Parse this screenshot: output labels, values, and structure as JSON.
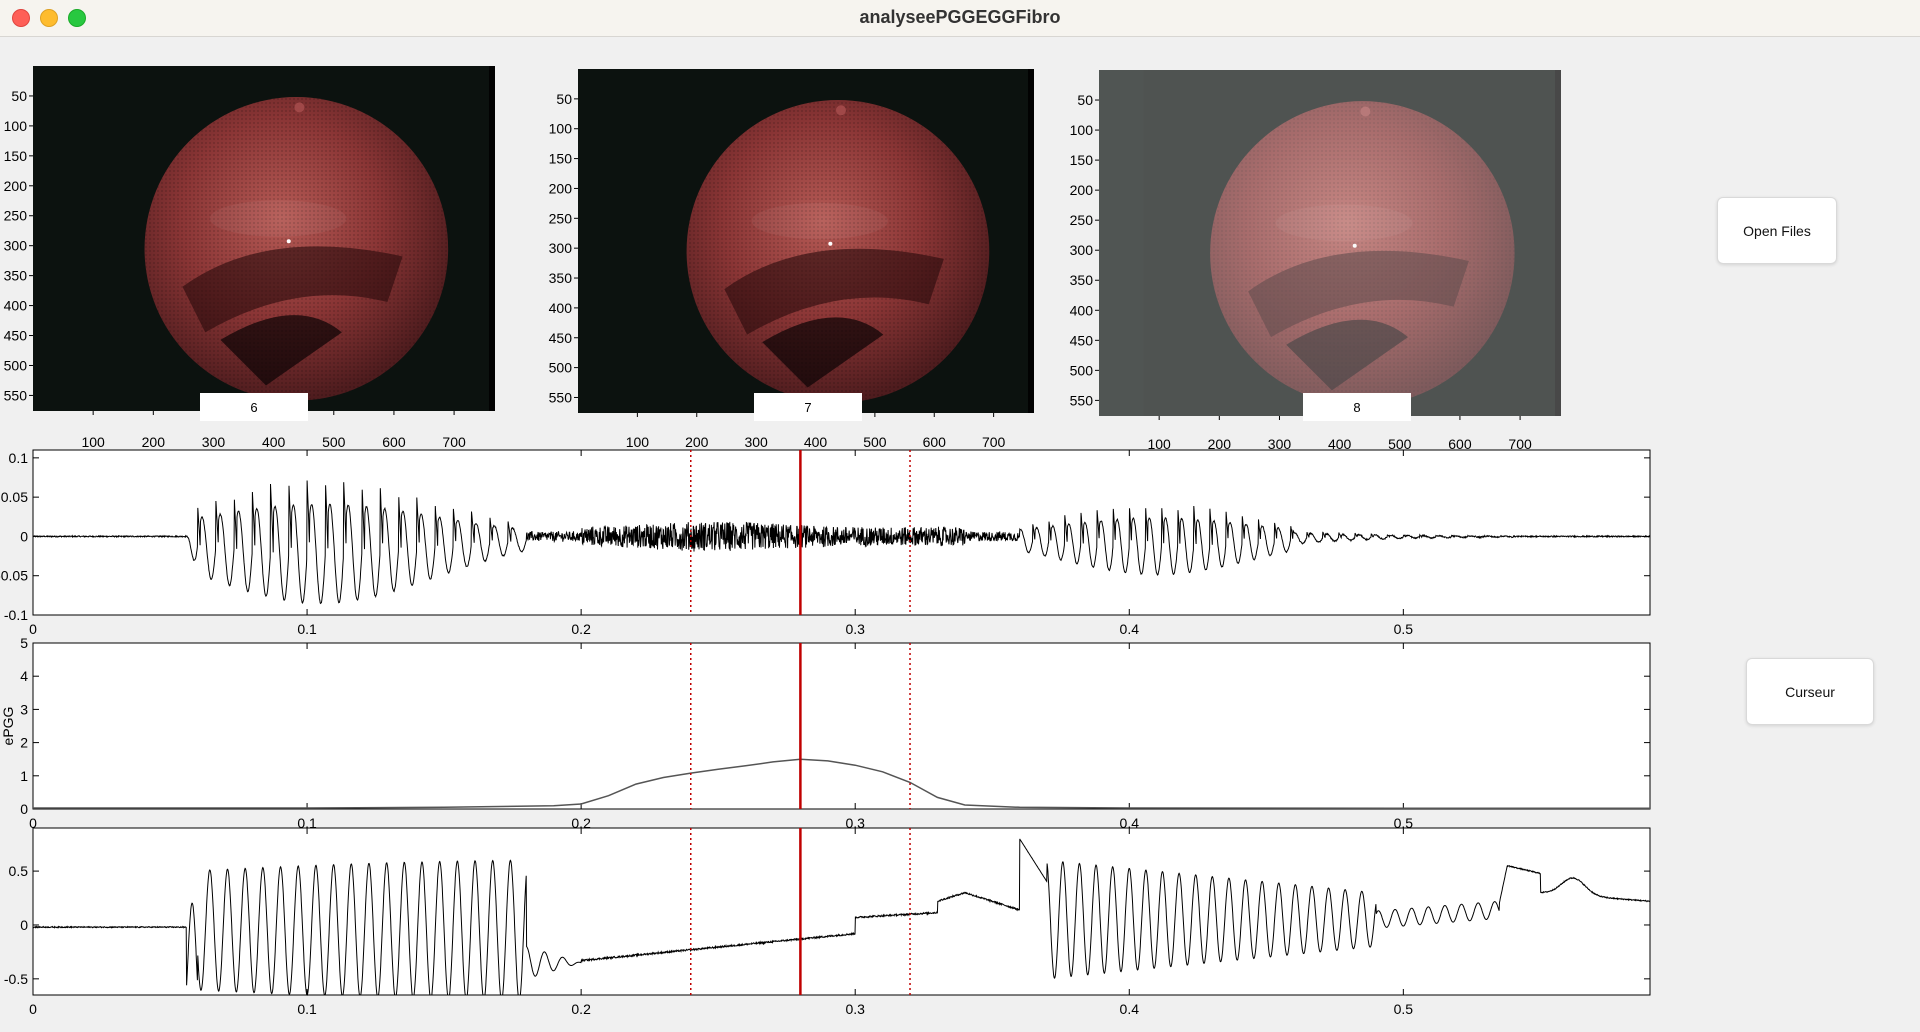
{
  "window": {
    "title": "analyseePGGEGGFibro"
  },
  "buttons": {
    "open_files": "Open Files",
    "cursor": "Curseur"
  },
  "frames": [
    {
      "label": "6",
      "brightness": 1.0,
      "xticks": [
        100,
        200,
        300,
        400,
        500,
        600,
        700
      ],
      "yticks": [
        50,
        100,
        150,
        200,
        250,
        300,
        350,
        400,
        450,
        500,
        550
      ]
    },
    {
      "label": "7",
      "brightness": 1.0,
      "xticks": [
        100,
        200,
        300,
        400,
        500,
        600,
        700
      ],
      "yticks": [
        50,
        100,
        150,
        200,
        250,
        300,
        350,
        400,
        450,
        500,
        550
      ]
    },
    {
      "label": "8",
      "brightness": 0.7,
      "xticks": [
        100,
        200,
        300,
        400,
        500,
        600,
        700
      ],
      "yticks": [
        50,
        100,
        150,
        200,
        250,
        300,
        350,
        400,
        450,
        500,
        550
      ]
    }
  ],
  "colors": {
    "cursor": "#c00000",
    "signal": "#000000",
    "epgg": "#555555",
    "tissue": "#9a3c3c"
  },
  "chart_data": [
    {
      "type": "line",
      "name": "audio",
      "xlim": [
        0,
        0.59
      ],
      "ylim": [
        -0.1,
        0.11
      ],
      "xticks": [
        0,
        0.1,
        0.2,
        0.3,
        0.4,
        0.5
      ],
      "yticks": [
        -0.1,
        -0.05,
        0,
        0.05,
        0.1
      ],
      "ylabel": "",
      "cursor": {
        "center": 0.28,
        "left": 0.24,
        "right": 0.32
      }
    },
    {
      "type": "line",
      "name": "epgg",
      "xlim": [
        0,
        0.59
      ],
      "ylim": [
        0,
        5
      ],
      "xticks": [
        0,
        0.1,
        0.2,
        0.3,
        0.4,
        0.5
      ],
      "yticks": [
        0,
        1,
        2,
        3,
        4,
        5
      ],
      "ylabel": "ePGG",
      "points": [
        [
          0,
          0.03
        ],
        [
          0.1,
          0.03
        ],
        [
          0.15,
          0.05
        ],
        [
          0.19,
          0.1
        ],
        [
          0.2,
          0.15
        ],
        [
          0.21,
          0.4
        ],
        [
          0.22,
          0.75
        ],
        [
          0.23,
          0.95
        ],
        [
          0.24,
          1.08
        ],
        [
          0.25,
          1.2
        ],
        [
          0.26,
          1.3
        ],
        [
          0.27,
          1.42
        ],
        [
          0.28,
          1.5
        ],
        [
          0.29,
          1.45
        ],
        [
          0.3,
          1.32
        ],
        [
          0.31,
          1.12
        ],
        [
          0.32,
          0.8
        ],
        [
          0.33,
          0.35
        ],
        [
          0.34,
          0.12
        ],
        [
          0.36,
          0.05
        ],
        [
          0.4,
          0.03
        ],
        [
          0.5,
          0.02
        ],
        [
          0.59,
          0.02
        ]
      ],
      "cursor": {
        "center": 0.28,
        "left": 0.24,
        "right": 0.32
      }
    },
    {
      "type": "line",
      "name": "egg",
      "xlim": [
        0,
        0.59
      ],
      "ylim": [
        -0.65,
        0.9
      ],
      "xticks": [
        0,
        0.1,
        0.2,
        0.3,
        0.4,
        0.5
      ],
      "yticks": [
        -0.5,
        0,
        0.5
      ],
      "ylabel": "",
      "cursor": {
        "center": 0.28,
        "left": 0.24,
        "right": 0.32
      }
    }
  ]
}
